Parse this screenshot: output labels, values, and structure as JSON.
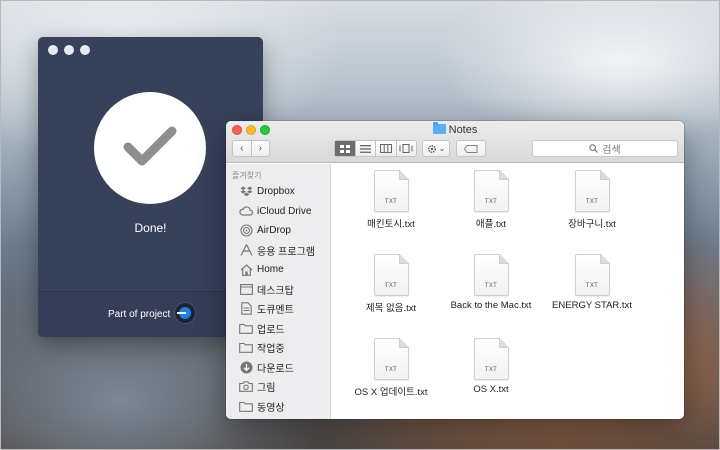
{
  "done_window": {
    "status_text": "Done!",
    "footer_label": "Part of project"
  },
  "finder": {
    "title": "Notes",
    "nav": {
      "back": "‹",
      "forward": "›"
    },
    "search_placeholder": "검색",
    "gear_caret": "⌄",
    "sidebar": {
      "section": "즐겨찾기",
      "items": [
        {
          "label": "Dropbox",
          "icon": "dropbox-icon"
        },
        {
          "label": "iCloud Drive",
          "icon": "cloud-icon"
        },
        {
          "label": "AirDrop",
          "icon": "airdrop-icon"
        },
        {
          "label": "응용 프로그램",
          "icon": "applications-icon"
        },
        {
          "label": "Home",
          "icon": "home-icon"
        },
        {
          "label": "데스크탑",
          "icon": "desktop-icon"
        },
        {
          "label": "도큐멘트",
          "icon": "document-icon"
        },
        {
          "label": "업로드",
          "icon": "folder-icon"
        },
        {
          "label": "작업중",
          "icon": "folder-icon"
        },
        {
          "label": "다운로드",
          "icon": "download-icon"
        },
        {
          "label": "그림",
          "icon": "camera-icon"
        },
        {
          "label": "동영상",
          "icon": "folder-icon"
        }
      ]
    },
    "files": [
      {
        "name": "매킨토시.txt",
        "ext": "TXT"
      },
      {
        "name": "애플.txt",
        "ext": "TXT"
      },
      {
        "name": "장바구니.txt",
        "ext": "TXT"
      },
      {
        "name": "제목 없음.txt",
        "ext": "TXT"
      },
      {
        "name": "Back to the Mac.txt",
        "ext": "TXT"
      },
      {
        "name": "ENERGY STAR.txt",
        "ext": "TXT"
      },
      {
        "name": "OS X 업데이트.txt",
        "ext": "TXT"
      },
      {
        "name": "OS X.txt",
        "ext": "TXT"
      }
    ]
  },
  "colors": {
    "done_bg": "#37415a",
    "accent_blue": "#1f7fe0",
    "folder_blue": "#5aaef6"
  }
}
